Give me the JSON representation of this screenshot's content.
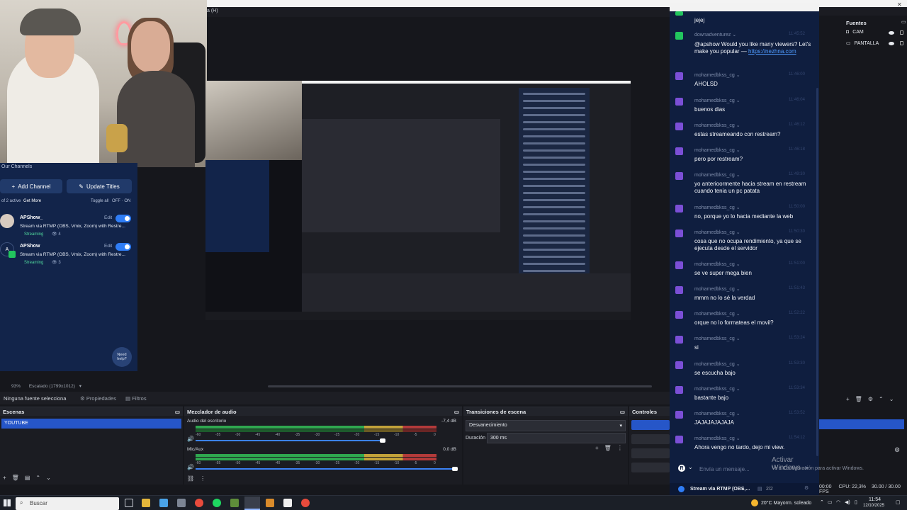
{
  "obs": {
    "menu_fragment": "a (H)",
    "zoom_label": "93%",
    "scale_label": "Escalado (1799x1012)",
    "no_source_label": "Ninguna fuente selecciona",
    "properties_label": "Propiedades",
    "filters_label": "Filtros"
  },
  "restream": {
    "header": "Our Channels",
    "add_channel": "Add Channel",
    "update_titles": "Update Titles",
    "active_info": "of 2 active",
    "get_more": "Get More",
    "toggle_all": "Toggle all",
    "off": "OFF",
    "on": "ON",
    "channels": [
      {
        "name": "APShow_",
        "desc": "Stream via RTMP (OBS, Vmix, Zoom) with Restre...",
        "status": "Streaming",
        "viewers": "4",
        "edit": "Edit",
        "platform": "twitch"
      },
      {
        "name": "APShow",
        "desc": "Stream via RTMP (OBS, Vmix, Zoom) with Restre...",
        "status": "Streaming",
        "viewers": "3",
        "edit": "Edit",
        "platform": "kick"
      }
    ],
    "help": "Need help?"
  },
  "docks": {
    "scenes_title": "Escenas",
    "scenes": [
      "YOUTUBE"
    ],
    "mixer_title": "Mezclador de audio",
    "mixer": [
      {
        "name": "Audio del escritorio",
        "db": "-7,4 dB"
      },
      {
        "name": "Mic/Aux",
        "db": "0,0 dB"
      }
    ],
    "meter_ticks": [
      "-60",
      "-55",
      "-50",
      "-45",
      "-40",
      "-35",
      "-30",
      "-25",
      "-20",
      "-15",
      "-10",
      "-5",
      "0"
    ],
    "transitions_title": "Transiciones de escena",
    "transition": "Desvanecimiento",
    "duration_label": "Duración",
    "duration_value": "300 ms",
    "controls_title": "Controles"
  },
  "sources": {
    "title": "Fuentes",
    "items": [
      "CAM",
      "PANTALLA"
    ]
  },
  "chat": {
    "messages": [
      {
        "platform": "twitch",
        "user": "",
        "time": "",
        "text": "jejej"
      },
      {
        "platform": "kick",
        "user": "downadventurez",
        "time": "11:45:52",
        "text": "@apshow Would you like many viewers? Let's make you popular — ",
        "link": "https://nezhna.com"
      },
      {
        "platform": "twitch",
        "user": "mohamedbkss_cg",
        "time": "11:46:00",
        "text": "AHOLSD"
      },
      {
        "platform": "twitch",
        "user": "mohamedbkss_cg",
        "time": "11:46:04",
        "text": "buenos dias"
      },
      {
        "platform": "twitch",
        "user": "mohamedbkss_cg",
        "time": "11:46:12",
        "text": "estas streameando con restream?"
      },
      {
        "platform": "twitch",
        "user": "mohamedbkss_cg",
        "time": "11:46:18",
        "text": "pero por restream?"
      },
      {
        "platform": "twitch",
        "user": "mohamedbkss_cg",
        "time": "11:49:30",
        "text": "yo anterioormente hacia stream en restream cuando tenia un pc patata"
      },
      {
        "platform": "twitch",
        "user": "mohamedbkss_cg",
        "time": "11:50:00",
        "text": "no, porque yo lo hacia mediante la web"
      },
      {
        "platform": "twitch",
        "user": "mohamedbkss_cg",
        "time": "11:50:30",
        "text": "cosa que no ocupa rendimiento, ya que se ejecuta desde el servidor"
      },
      {
        "platform": "twitch",
        "user": "mohamedbkss_cg",
        "time": "11:51:00",
        "text": "se ve super mega bien"
      },
      {
        "platform": "twitch",
        "user": "mohamedbkss_cg",
        "time": "11:51:43",
        "text": "mmm no lo sé la verdad"
      },
      {
        "platform": "twitch",
        "user": "mohamedbkss_cg",
        "time": "11:52:22",
        "text": "orque no lo formateas el movil?"
      },
      {
        "platform": "twitch",
        "user": "mohamedbkss_cg",
        "time": "11:53:24",
        "text": "si"
      },
      {
        "platform": "twitch",
        "user": "mohamedbkss_cg",
        "time": "11:53:30",
        "text": "se escucha bajo"
      },
      {
        "platform": "twitch",
        "user": "mohamedbkss_cg",
        "time": "11:53:34",
        "text": "bastante bajo"
      },
      {
        "platform": "twitch",
        "user": "mohamedbkss_cg",
        "time": "11:53:52",
        "text": "JAJAJAJAJAJA"
      },
      {
        "platform": "twitch",
        "user": "mohamedbkss_cg",
        "time": "11:54:12",
        "text": "Ahora vengo no tardo, dejo mi view."
      }
    ],
    "input_placeholder": "Envía un mensaje...",
    "footer_stream": "Stream via RTMP (OBS,...",
    "footer_count": "2/2",
    "activate_title": "Activar Windows",
    "activate_sub": "Ve a Configuración para activar Windows."
  },
  "stats": {
    "time": "00:00",
    "cpu": "CPU: 22,3%",
    "fps": "30.00 / 30.00 FPS"
  },
  "taskbar": {
    "search_placeholder": "Buscar",
    "weather": "20°C  Mayorm. soleado",
    "clock_time": "11:54",
    "clock_date": "12/10/2025"
  },
  "colors": {
    "chat_bg": "#0f1e3f",
    "accent": "#2656c8",
    "twitch": "#7b4fd6",
    "kick": "#22c55e"
  }
}
